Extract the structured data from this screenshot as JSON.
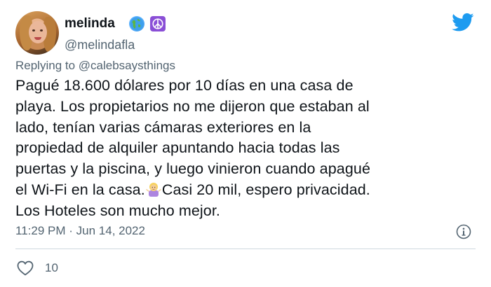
{
  "author": {
    "display_name": "melinda",
    "handle": "@melindafla",
    "badges": [
      "globe-americas-icon",
      "peace-symbol-icon"
    ]
  },
  "reply": {
    "prefix": "Replying to ",
    "target": "@calebsaysthings"
  },
  "tweet": {
    "lines": [
      "Pagué 18.600 dólares por 10 días en una casa de",
      "playa. Los propietarios no me dijeron que estaban al",
      "lado, tenían varias cámaras exteriores en la",
      "propiedad de alquiler apuntando hacia todas las",
      "puertas y la piscina, y luego vinieron cuando apagué",
      "el Wi-Fi en la casa.",
      "Los Hoteles son mucho mejor."
    ],
    "line6_after_emoji": "Casi 20 mil, espero privacidad.",
    "emoji": "woman-shrugging-emoji"
  },
  "meta": {
    "time": "11:29 PM",
    "separator": "·",
    "date": "Jun 14, 2022"
  },
  "actions": {
    "like_count": "10"
  },
  "colors": {
    "twitter_blue": "#1d9bf0",
    "text": "#0f1419",
    "secondary": "#536471",
    "divider": "#cfd9de"
  }
}
